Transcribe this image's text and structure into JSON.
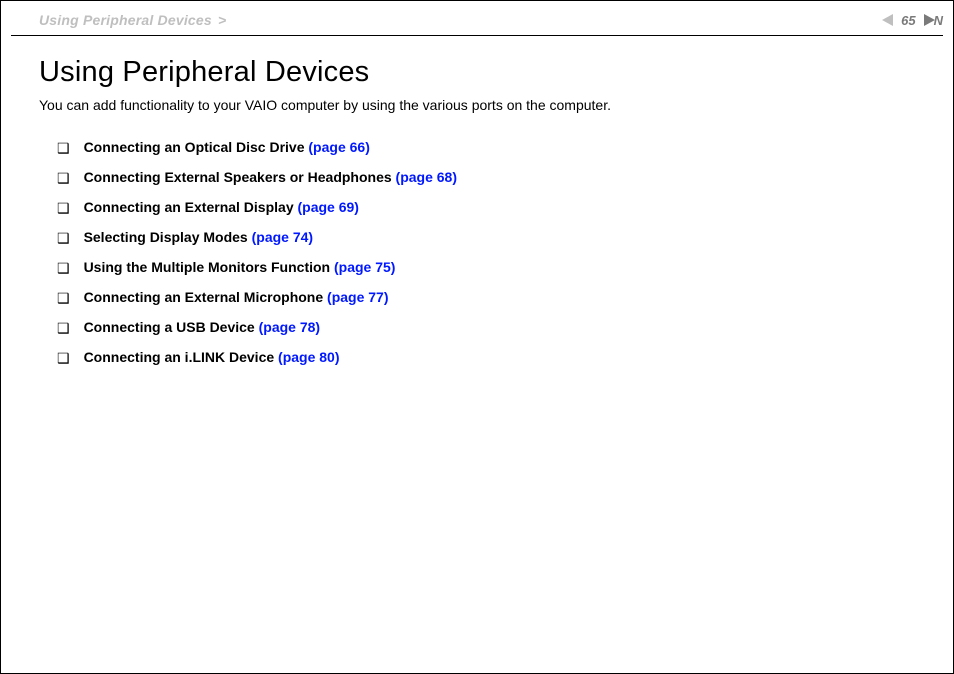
{
  "breadcrumb": {
    "section": "Using Peripheral Devices",
    "separator": ">"
  },
  "page_number": "65",
  "nav": {
    "next_label": "N"
  },
  "title": "Using Peripheral Devices",
  "intro": "You can add functionality to your VAIO computer by using the various ports on the computer.",
  "bullet": "❑",
  "links": [
    {
      "text": "Connecting an Optical Disc Drive ",
      "pageref": "(page 66)"
    },
    {
      "text": "Connecting External Speakers or Headphones ",
      "pageref": "(page 68)"
    },
    {
      "text": "Connecting an External Display ",
      "pageref": "(page 69)"
    },
    {
      "text": "Selecting Display Modes ",
      "pageref": "(page 74)"
    },
    {
      "text": "Using the Multiple Monitors Function ",
      "pageref": "(page 75)"
    },
    {
      "text": "Connecting an External Microphone ",
      "pageref": "(page 77)"
    },
    {
      "text": "Connecting a USB Device ",
      "pageref": "(page 78)"
    },
    {
      "text": "Connecting an i.LINK Device ",
      "pageref": "(page 80)"
    }
  ]
}
